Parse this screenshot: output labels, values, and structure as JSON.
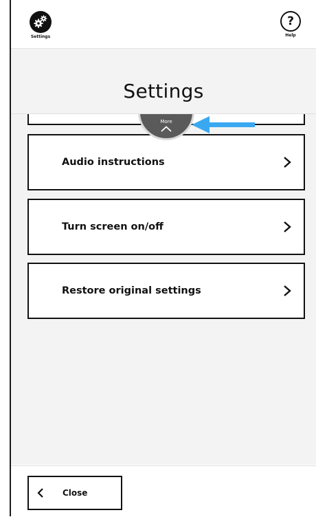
{
  "header": {
    "settings_label": "Settings",
    "settings_icon": "gears-icon",
    "help_symbol": "?",
    "help_label": "Help"
  },
  "page": {
    "title": "Settings"
  },
  "more": {
    "label": "More",
    "icon": "chevron-up-icon"
  },
  "annotation": {
    "arrow_color": "#3aa8f0"
  },
  "items": [
    {
      "label": "Audio instructions"
    },
    {
      "label": "Turn screen on/off"
    },
    {
      "label": "Restore original settings"
    }
  ],
  "footer": {
    "close_label": "Close"
  }
}
